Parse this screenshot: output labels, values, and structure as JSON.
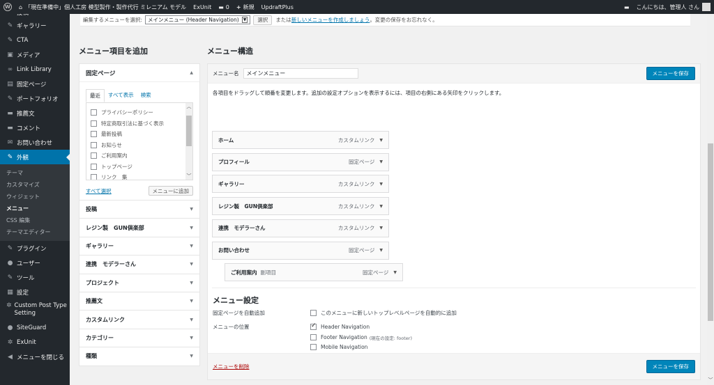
{
  "adminbar": {
    "site_name": "「現在準備中」個人工房 模型製作・製作代行 ミレニアム モデル",
    "exunit": "ExUnit",
    "comments_count": "0",
    "new_label": "新規",
    "updraft": "UpdraftPlus",
    "greeting": "こんにちは、管理人 さん"
  },
  "sidebar": {
    "top_partial": "投稿",
    "items_before": [
      {
        "icon": "gallery-icon",
        "glyph": "✎",
        "label": "ギャラリー"
      },
      {
        "icon": "pin-icon",
        "glyph": "✎",
        "label": "CTA"
      },
      {
        "icon": "media-icon",
        "glyph": "▣",
        "label": "メディア"
      },
      {
        "icon": "link-icon",
        "glyph": "∞",
        "label": "Link Library"
      },
      {
        "icon": "page-icon",
        "glyph": "▤",
        "label": "固定ページ"
      },
      {
        "icon": "portfolio-icon",
        "glyph": "✎",
        "label": "ポートフォリオ"
      },
      {
        "icon": "testimonial-icon",
        "glyph": "▬",
        "label": "推薦文"
      },
      {
        "icon": "comment-icon",
        "glyph": "▬",
        "label": "コメント"
      },
      {
        "icon": "mail-icon",
        "glyph": "✉",
        "label": "お問い合わせ"
      }
    ],
    "active": {
      "icon": "appearance-icon",
      "glyph": "✎",
      "label": "外観"
    },
    "submenu": [
      "テーマ",
      "カスタマイズ",
      "ウィジェット",
      "メニュー",
      "CSS 編集",
      "テーマエディター"
    ],
    "submenu_current_index": 3,
    "items_after": [
      {
        "icon": "plugin-icon",
        "glyph": "✎",
        "label": "プラグイン"
      },
      {
        "icon": "user-icon",
        "glyph": "●",
        "label": "ユーザー"
      },
      {
        "icon": "tools-icon",
        "glyph": "✎",
        "label": "ツール"
      },
      {
        "icon": "settings-icon",
        "glyph": "▦",
        "label": "設定"
      }
    ],
    "cpt": {
      "icon": "gear-icon",
      "glyph": "✲",
      "label": "Custom Post Type Setting"
    },
    "items_tail": [
      {
        "icon": "siteguard-icon",
        "glyph": "●",
        "label": "SiteGuard"
      },
      {
        "icon": "gear-icon",
        "glyph": "✲",
        "label": "ExUnit"
      },
      {
        "icon": "collapse-icon",
        "glyph": "◀",
        "label": "メニューを閉じる"
      }
    ]
  },
  "topbar": {
    "select_label": "編集するメニューを選択:",
    "selected_menu": "メインメニュー (Header Navigation)",
    "select_button": "選択",
    "or_text": "または",
    "create_link": "新しいメニューを作成しましょう",
    "save_reminder": "。変更の保存をお忘れなく。"
  },
  "left": {
    "title": "メニュー項目を追加",
    "pages_box": {
      "title": "固定ページ",
      "tabs": [
        "最近",
        "すべて表示",
        "検索"
      ],
      "active_tab": 0,
      "pages": [
        "プライバシーポリシー",
        "特定商取引法に基づく表示",
        "最新投稿",
        "お知らせ",
        "ご利用案内",
        "トップページ",
        "リンク　集"
      ],
      "select_all": "すべて選択",
      "add_button": "メニューに追加"
    },
    "accordions": [
      "投稿",
      "レジン製　GUN倶楽部",
      "ギャラリー",
      "連携　モデラーさん",
      "プロジェクト",
      "推薦文",
      "カスタムリンク",
      "カテゴリー",
      "種類"
    ]
  },
  "right": {
    "title": "メニュー構造",
    "menu_name_label": "メニュー名",
    "menu_name_value": "メインメニュー",
    "save_button": "メニューを保存",
    "instructions": "各項目をドラッグして順番を変更します。追加の設定オプションを表示するには、項目の右側にある矢印をクリックします。",
    "items": [
      {
        "title": "ホーム",
        "type": "カスタムリンク",
        "sub": false,
        "subnote": ""
      },
      {
        "title": "プロフィール",
        "type": "固定ページ",
        "sub": false,
        "subnote": ""
      },
      {
        "title": "ギャラリー",
        "type": "カスタムリンク",
        "sub": false,
        "subnote": ""
      },
      {
        "title": "レジン製　GUN倶楽部",
        "type": "カスタムリンク",
        "sub": false,
        "subnote": ""
      },
      {
        "title": "連携　モデラーさん",
        "type": "カスタムリンク",
        "sub": false,
        "subnote": ""
      },
      {
        "title": "お問い合わせ",
        "type": "固定ページ",
        "sub": false,
        "subnote": ""
      },
      {
        "title": "ご利用案内",
        "type": "固定ページ",
        "sub": true,
        "subnote": "副項目"
      }
    ],
    "settings": {
      "title": "メニュー設定",
      "auto_add_label": "固定ページを自動追加",
      "auto_add_option": "このメニューに新しいトップレベルページを自動的に追加",
      "auto_add_checked": false,
      "location_label": "メニューの位置",
      "locations": [
        {
          "label": "Header Navigation",
          "note": "",
          "checked": true
        },
        {
          "label": "Footer Navigation",
          "note": "(現在の設定: footer)",
          "checked": false
        },
        {
          "label": "Mobile Navigation",
          "note": "",
          "checked": false
        }
      ]
    },
    "delete_link": "メニューを削除"
  }
}
